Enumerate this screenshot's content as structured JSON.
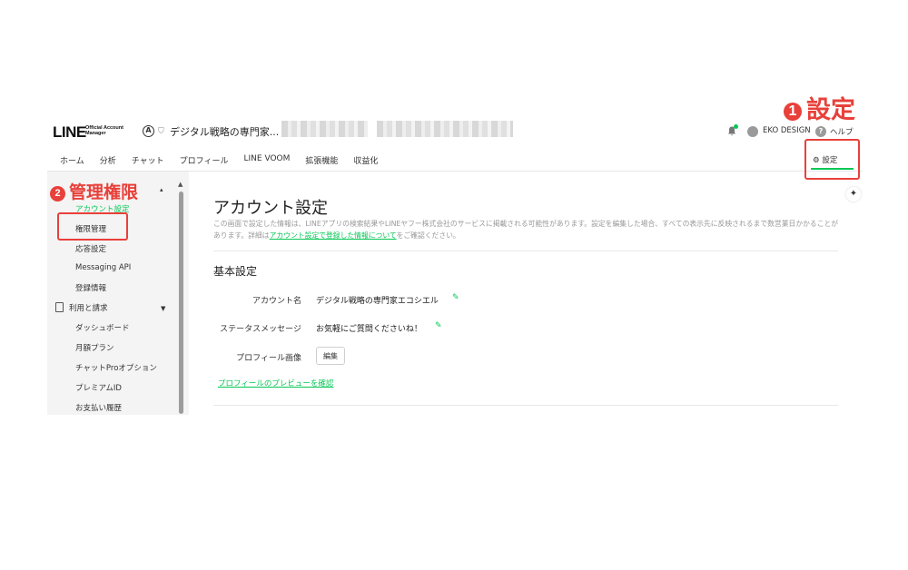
{
  "header": {
    "logo_text": "LINE",
    "logo_sub": "Official Account Manager",
    "account_name": "デジタル戦略の専門家...",
    "user_name": "EKO DESIGN",
    "help_label": "ヘルプ"
  },
  "annotations": {
    "one_num": "1",
    "one_label": "設定",
    "two_num": "2",
    "two_label": "管理権限"
  },
  "nav": {
    "items": [
      "ホーム",
      "分析",
      "チャット",
      "プロフィール",
      "LINE VOOM",
      "拡張機能",
      "収益化"
    ],
    "settings_label": "設定"
  },
  "sidebar": {
    "account_settings": "アカウント設定",
    "items": [
      "権限管理",
      "応答設定",
      "Messaging API",
      "登録情報"
    ],
    "billing_header": "利用と請求",
    "billing_items": [
      "ダッシュボード",
      "月額プラン",
      "チャットProオプション",
      "プレミアムID",
      "お支払い履歴"
    ]
  },
  "main": {
    "title": "アカウント設定",
    "desc_part1": "この画面で設定した情報は、LINEアプリの検索結果やLINEヤフー株式会社のサービスに掲載される可能性があります。設定を編集した場合、すべての表示先に反映されるまで数営業日かかることがあります。詳細は",
    "desc_link": "アカウント設定で登録した情報について",
    "desc_part2": "をご確認ください。",
    "section_title": "基本設定",
    "account_name_label": "アカウント名",
    "account_name_value": "デジタル戦略の専門家エコシエル",
    "status_label": "ステータスメッセージ",
    "status_value": "お気軽にご質問くださいね！",
    "profile_image_label": "プロフィール画像",
    "edit_button": "編集",
    "preview_link": "プロフィールのプレビューを確認"
  },
  "colors": {
    "brand_green": "#06c755",
    "annotation_red": "#e8403a"
  }
}
